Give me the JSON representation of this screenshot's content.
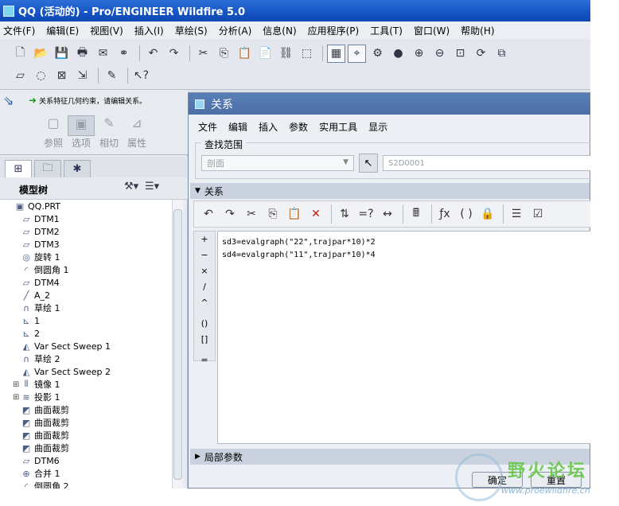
{
  "window": {
    "title": "QQ (活动的) - Pro/ENGINEER Wildfire 5.0"
  },
  "menubar": [
    "文件(F)",
    "编辑(E)",
    "视图(V)",
    "插入(I)",
    "草绘(S)",
    "分析(A)",
    "信息(N)",
    "应用程序(P)",
    "工具(T)",
    "窗口(W)",
    "帮助(H)"
  ],
  "dashboard": {
    "message": "关系特征几何约束，请编辑关系。",
    "tabs": [
      "参照",
      "选项",
      "相切",
      "属性"
    ]
  },
  "model_tree": {
    "title": "模型树",
    "items": [
      {
        "label": "QQ.PRT",
        "icon": "part-icon",
        "level": 0,
        "expandable": false
      },
      {
        "label": "DTM1",
        "icon": "datum-plane-icon",
        "level": 1,
        "expandable": false
      },
      {
        "label": "DTM2",
        "icon": "datum-plane-icon",
        "level": 1,
        "expandable": false
      },
      {
        "label": "DTM3",
        "icon": "datum-plane-icon",
        "level": 1,
        "expandable": false
      },
      {
        "label": "旋转 1",
        "icon": "revolve-icon",
        "level": 1,
        "expandable": false
      },
      {
        "label": "倒圆角 1",
        "icon": "round-icon",
        "level": 1,
        "expandable": false
      },
      {
        "label": "DTM4",
        "icon": "datum-plane-icon",
        "level": 1,
        "expandable": false
      },
      {
        "label": "A_2",
        "icon": "datum-axis-icon",
        "level": 1,
        "expandable": false
      },
      {
        "label": "草绘 1",
        "icon": "sketch-icon",
        "level": 1,
        "expandable": false
      },
      {
        "label": "1",
        "icon": "graph-icon",
        "level": 1,
        "expandable": false
      },
      {
        "label": "2",
        "icon": "graph-icon",
        "level": 1,
        "expandable": false
      },
      {
        "label": "Var Sect Sweep 1",
        "icon": "sweep-icon",
        "level": 1,
        "expandable": false
      },
      {
        "label": "草绘 2",
        "icon": "sketch-icon",
        "level": 1,
        "expandable": false
      },
      {
        "label": "Var Sect Sweep 2",
        "icon": "sweep-icon",
        "level": 1,
        "expandable": false
      },
      {
        "label": "镜像 1",
        "icon": "mirror-icon",
        "level": 1,
        "expandable": true
      },
      {
        "label": "投影 1",
        "icon": "project-icon",
        "level": 1,
        "expandable": true
      },
      {
        "label": "曲面裁剪",
        "icon": "trim-icon",
        "level": 1,
        "expandable": false
      },
      {
        "label": "曲面裁剪",
        "icon": "trim-icon",
        "level": 1,
        "expandable": false
      },
      {
        "label": "曲面裁剪",
        "icon": "trim-icon",
        "level": 1,
        "expandable": false
      },
      {
        "label": "曲面裁剪",
        "icon": "trim-icon",
        "level": 1,
        "expandable": false
      },
      {
        "label": "DTM6",
        "icon": "datum-plane-icon",
        "level": 1,
        "expandable": false
      },
      {
        "label": "合并 1",
        "icon": "merge-icon",
        "level": 1,
        "expandable": false
      },
      {
        "label": "倒圆角 2",
        "icon": "round-icon",
        "level": 1,
        "expandable": false
      }
    ]
  },
  "relations_dialog": {
    "title": "关系",
    "menu": [
      "文件",
      "编辑",
      "插入",
      "参数",
      "实用工具",
      "显示"
    ],
    "scope": {
      "legend": "查找范围",
      "type_value": "剖面",
      "object_value": "S2D0001"
    },
    "section_label": "关系",
    "operators": [
      "+",
      "−",
      "×",
      "/",
      "^",
      "()",
      "[]",
      "="
    ],
    "relations": [
      "sd3=evalgraph(\"22\",trajpar*10)*2",
      "sd4=evalgraph(\"11\",trajpar*10)*4"
    ],
    "local_params_label": "局部参数",
    "ok_label": "确定",
    "reset_label": "重置"
  },
  "watermark": {
    "title": "野火论坛",
    "url": "www.proewildfire.cn"
  }
}
